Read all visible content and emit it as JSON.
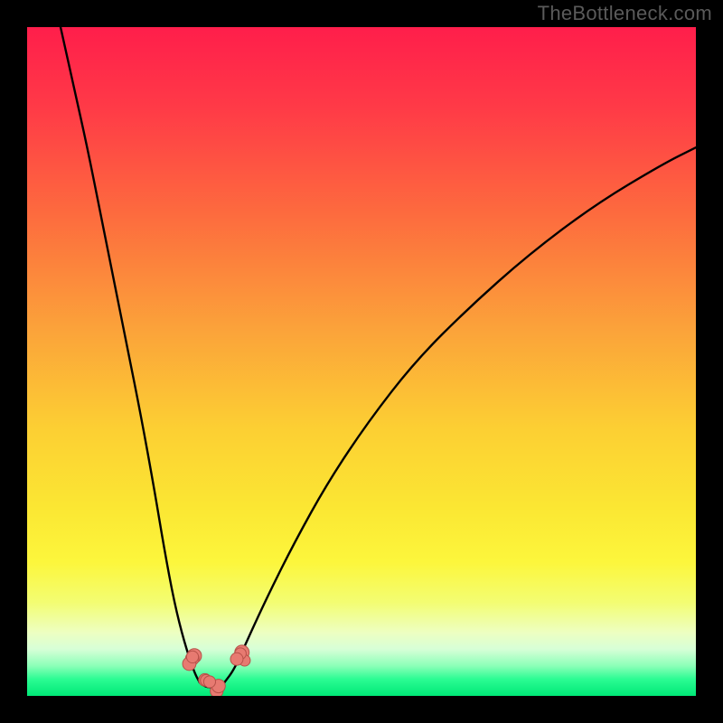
{
  "watermark": "TheBottleneck.com",
  "colors": {
    "black": "#000000",
    "dot_fill": "#e77a71",
    "dot_stroke": "#b75149",
    "curve": "#000000"
  },
  "chart_data": {
    "type": "line",
    "title": "",
    "xlabel": "",
    "ylabel": "",
    "xlim": [
      0,
      100
    ],
    "ylim": [
      0,
      100
    ],
    "gradient_stops": [
      {
        "offset": 0.0,
        "color": "#ff1e4b"
      },
      {
        "offset": 0.12,
        "color": "#ff3a47"
      },
      {
        "offset": 0.28,
        "color": "#fd6b3e"
      },
      {
        "offset": 0.45,
        "color": "#fba23a"
      },
      {
        "offset": 0.6,
        "color": "#fccf33"
      },
      {
        "offset": 0.72,
        "color": "#fbe733"
      },
      {
        "offset": 0.8,
        "color": "#fcf63c"
      },
      {
        "offset": 0.86,
        "color": "#f3fd72"
      },
      {
        "offset": 0.905,
        "color": "#edffc1"
      },
      {
        "offset": 0.93,
        "color": "#d7ffd7"
      },
      {
        "offset": 0.955,
        "color": "#8cffb8"
      },
      {
        "offset": 0.975,
        "color": "#2bfc93"
      },
      {
        "offset": 1.0,
        "color": "#00e877"
      }
    ],
    "series": [
      {
        "name": "bottleneck-curve-left",
        "x": [
          5,
          7,
          9,
          11,
          13,
          15,
          17,
          19,
          20.5,
          22,
          23.5,
          25,
          25.8
        ],
        "y": [
          100,
          91,
          82,
          72,
          62,
          52,
          42,
          31,
          22,
          14,
          8,
          3.5,
          2
        ]
      },
      {
        "name": "bottleneck-curve-right",
        "x": [
          29.5,
          31,
          33,
          36,
          40,
          45,
          51,
          58,
          66,
          75,
          85,
          95,
          100
        ],
        "y": [
          2,
          4,
          8.5,
          15,
          23,
          32,
          41,
          50,
          58,
          66,
          73.5,
          79.5,
          82
        ]
      },
      {
        "name": "bottleneck-curve-min",
        "x": [
          25.8,
          26.6,
          27.6,
          28.6,
          29.5
        ],
        "y": [
          2,
          1.4,
          1.2,
          1.4,
          2
        ]
      }
    ],
    "dot_clusters": [
      {
        "name": "cluster-left",
        "cx": 24.0,
        "cy": 5.5,
        "spread": 1.3,
        "count": 4
      },
      {
        "name": "cluster-right",
        "cx": 31.5,
        "cy": 5.8,
        "spread": 1.3,
        "count": 4
      },
      {
        "name": "cluster-min",
        "cx": 27.8,
        "cy": 1.6,
        "spread": 1.6,
        "count": 5
      }
    ]
  }
}
